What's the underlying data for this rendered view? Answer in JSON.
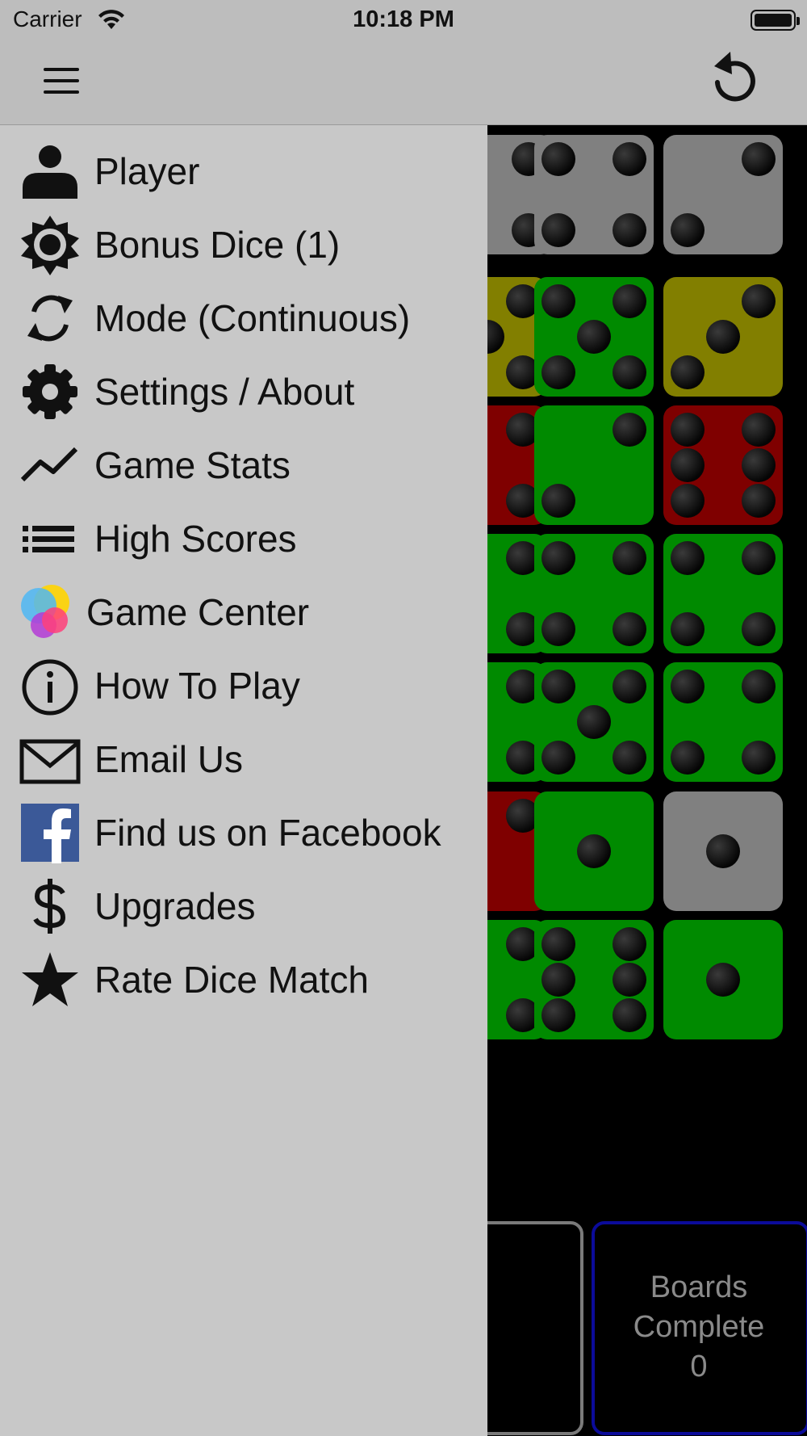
{
  "status_bar": {
    "carrier": "Carrier",
    "time": "10:18 PM"
  },
  "menu": {
    "items": [
      {
        "label": "Player",
        "icon": "person-icon"
      },
      {
        "label": "Bonus Dice (1)",
        "icon": "sun-gear-icon"
      },
      {
        "label": "Mode (Continuous)",
        "icon": "cycle-arrows-icon"
      },
      {
        "label": "Settings / About",
        "icon": "gear-icon"
      },
      {
        "label": "Game Stats",
        "icon": "line-chart-icon"
      },
      {
        "label": "High Scores",
        "icon": "list-icon"
      },
      {
        "label": "Game Center",
        "icon": "game-center-icon"
      },
      {
        "label": "How To Play",
        "icon": "info-icon"
      },
      {
        "label": "Email Us",
        "icon": "envelope-icon"
      },
      {
        "label": "Find us on Facebook",
        "icon": "facebook-icon"
      },
      {
        "label": "Upgrades",
        "icon": "dollar-icon"
      },
      {
        "label": "Rate Dice Match",
        "icon": "star-icon"
      }
    ]
  },
  "board": {
    "dice": [
      {
        "color": "grey",
        "value": 4
      },
      {
        "color": "grey",
        "value": 4
      },
      {
        "color": "grey",
        "value": 2
      },
      {
        "color": "yellow",
        "value": 5
      },
      {
        "color": "green",
        "value": 5
      },
      {
        "color": "yellow",
        "value": 3
      },
      {
        "color": "red",
        "value": 4
      },
      {
        "color": "green",
        "value": 2
      },
      {
        "color": "red",
        "value": 6
      },
      {
        "color": "green",
        "value": 4
      },
      {
        "color": "green",
        "value": 4
      },
      {
        "color": "green",
        "value": 4
      },
      {
        "color": "green",
        "value": 4
      },
      {
        "color": "green",
        "value": 5
      },
      {
        "color": "green",
        "value": 4
      },
      {
        "color": "red",
        "value": 2
      },
      {
        "color": "green",
        "value": 1
      },
      {
        "color": "grey",
        "value": 1
      },
      {
        "color": "green",
        "value": 4
      },
      {
        "color": "green",
        "value": 6
      },
      {
        "color": "green",
        "value": 1
      }
    ],
    "colors": {
      "grey": "#808080",
      "green": "#008a00",
      "yellow": "#827f00",
      "red": "#7f0000"
    }
  },
  "boards_complete": {
    "line1": "Boards",
    "line2": "Complete",
    "count": "0"
  }
}
